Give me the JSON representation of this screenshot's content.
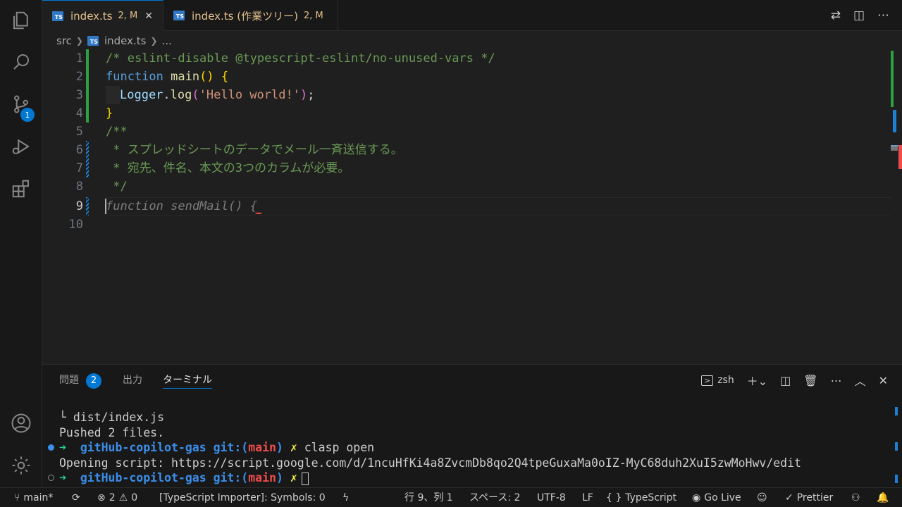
{
  "tabs": [
    {
      "file": "index.ts",
      "status": "2, M",
      "close": "✕"
    },
    {
      "file": "index.ts (作業ツリー)",
      "status": "2, M"
    }
  ],
  "breadcrumb": {
    "folder": "src",
    "file": "index.ts",
    "more": "..."
  },
  "editor": {
    "line_numbers": [
      "1",
      "2",
      "3",
      "4",
      "5",
      "6",
      "7",
      "8",
      "9",
      "10"
    ],
    "lines": {
      "l1": "/* eslint-disable @typescript-eslint/no-unused-vars */",
      "l2_kw": "function",
      "l2_fn": "main",
      "l2_paren": "()",
      "l2_brace": "{",
      "l3_obj": "Logger",
      "l3_dot": ".",
      "l3_fn": "log",
      "l3_open": "(",
      "l3_str": "'Hello world!'",
      "l3_close": ")",
      "l3_semi": ";",
      "l4": "}",
      "l5": "/**",
      "l6": " * スプレッドシートのデータでメール一斉送信する。",
      "l7": " * 宛先、件名、本文の3つのカラムが必要。",
      "l8": " */",
      "l9_ghost": "function sendMail() {"
    }
  },
  "panel": {
    "tabs": {
      "problems": "問題",
      "problems_count": "2",
      "output": "出力",
      "terminal": "ターミナル"
    },
    "shell": "zsh",
    "terminal": {
      "t1": "└ dist/index.js",
      "t2": "Pushed 2 files.",
      "arrow": "➜",
      "dir": "gitHub-copilot-gas",
      "git": "git:(",
      "branch": "main",
      "git_close": ")",
      "x": "✗",
      "cmd": "clasp open",
      "t4": "Opening script: https://script.google.com/d/1ncuHfKi4a8ZvcmDb8qo2Q4tpeGuxaMa0oIZ-MyC68duh2XuI5zwMoHwv/edit"
    }
  },
  "status": {
    "branch": "main*",
    "errors": "2",
    "warnings": "0",
    "importer": "[TypeScript Importer]: Symbols: 0",
    "position": "行 9、列 1",
    "spaces": "スペース: 2",
    "encoding": "UTF-8",
    "eol": "LF",
    "braces": "{ }",
    "language": "TypeScript",
    "golive": "Go Live",
    "prettier": "Prettier"
  },
  "activity": {
    "scm_badge": "1"
  },
  "colors": {
    "accent": "#0078d4",
    "modified": "#e2c08d",
    "added": "#2ea043"
  }
}
